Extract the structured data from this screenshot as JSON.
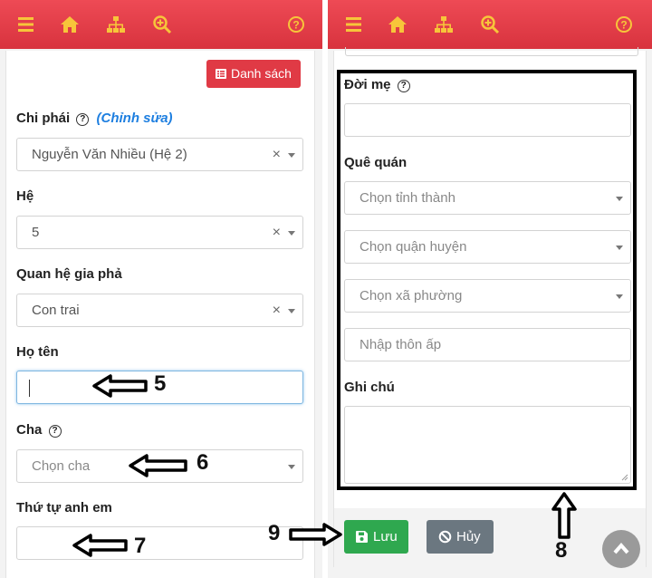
{
  "left": {
    "list_button": "Danh sách",
    "branch": {
      "label": "Chi phái",
      "help": "?",
      "edit": "(Chỉnh sửa)",
      "value": "Nguyễn Văn Nhiều (Hệ 2)",
      "clear": "×"
    },
    "generation": {
      "label": "Hệ",
      "value": "5",
      "clear": "×"
    },
    "relation": {
      "label": "Quan hệ gia phả",
      "value": "Con trai",
      "clear": "×"
    },
    "fullname": {
      "label": "Họ tên",
      "value": ""
    },
    "father": {
      "label": "Cha",
      "help": "?",
      "placeholder": "Chọn cha"
    },
    "sibling_order": {
      "label": "Thứ tự anh em",
      "value": ""
    }
  },
  "right": {
    "mother_gen": {
      "label": "Đời mẹ",
      "help": "?"
    },
    "hometown": {
      "label": "Quê quán",
      "province": "Chọn tỉnh thành",
      "district": "Chọn quận huyện",
      "ward": "Chọn xã phường",
      "hamlet": "Nhập thôn ấp"
    },
    "note": {
      "label": "Ghi chú"
    },
    "save": "Lưu",
    "cancel": "Hủy"
  },
  "annotations": {
    "n5": "5",
    "n6": "6",
    "n7": "7",
    "n8": "8",
    "n9": "9"
  },
  "colors": {
    "topbar": "#e03a45",
    "icon": "#f7c53a",
    "list_button": "#e03a45",
    "save": "#2fa84f",
    "cancel": "#6b7780"
  },
  "icons": [
    "menu-icon",
    "home-icon",
    "sitemap-icon",
    "zoom-in-icon",
    "question-icon",
    "list-icon",
    "save-icon",
    "ban-icon",
    "chevron-up-icon"
  ]
}
